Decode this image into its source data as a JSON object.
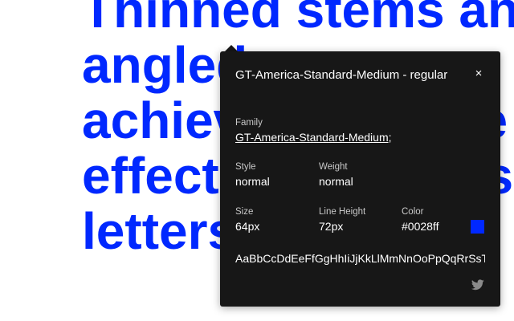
{
  "specimen": {
    "lines": [
      "Thinned stems and",
      "angled spurs",
      "achieve the same",
      "effect in lowercase",
      "letters b and p."
    ]
  },
  "panel": {
    "title": "GT-America-Standard-Medium - regular",
    "close_symbol": "×",
    "family_label": "Family",
    "family_value": "GT-America-Standard-Medium",
    "family_suffix": ";",
    "style_label": "Style",
    "style_value": "normal",
    "weight_label": "Weight",
    "weight_value": "normal",
    "size_label": "Size",
    "size_value": "64px",
    "line_height_label": "Line Height",
    "line_height_value": "72px",
    "color_label": "Color",
    "color_value": "#0028ff",
    "glyphs": "AaBbCcDdEeFfGgHhIiJjKkLlMmNnOoPpQqRrSsTtUuVvWwXxYyZz",
    "share_icon": "twitter-icon"
  },
  "colors": {
    "specimen_text": "#0028ff",
    "panel_background": "#171717",
    "swatch": "#0028ff"
  }
}
